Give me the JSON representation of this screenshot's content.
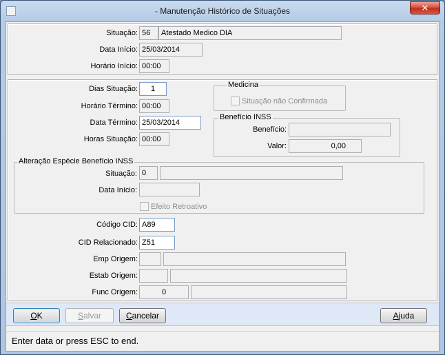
{
  "window": {
    "title": "- Manutenção Histórico de Situações",
    "close_symbol": "✕"
  },
  "top": {
    "situacao_label": "Situação:",
    "situacao_code": "56",
    "situacao_desc": "Atestado Medico DIA",
    "data_inicio_label": "Data Início:",
    "data_inicio": "25/03/2014",
    "horario_inicio_label": "Horário Início:",
    "horario_inicio": "00:00"
  },
  "mid": {
    "dias_situacao_label": "Dias Situação:",
    "dias_situacao": "1",
    "horario_termino_label": "Horário Término:",
    "horario_termino": "00:00",
    "data_termino_label": "Data Término:",
    "data_termino": "25/03/2014",
    "horas_situacao_label": "Horas Situação:",
    "horas_situacao": "00:00",
    "medicina_title": "Medicina",
    "situacao_nao_confirmada": "Situação não Confirmada",
    "beneficio_inss_title": "Benefício INSS",
    "beneficio_label": "Benefício:",
    "beneficio": "",
    "valor_label": "Valor:",
    "valor": "0,00",
    "alteracao_title": "Alteração Espécie Benefício INSS",
    "alt_situacao_label": "Situação:",
    "alt_situacao_code": "0",
    "alt_situacao_desc": "",
    "alt_data_inicio_label": "Data Início:",
    "alt_data_inicio": "",
    "efeito_retroativo": "Efeito Retroativo",
    "codigo_cid_label": "Código CID:",
    "codigo_cid": "A89",
    "cid_relacionado_label": "CID Relacionado:",
    "cid_relacionado": "Z51",
    "emp_origem_label": "Emp Origem:",
    "emp_origem_code": "",
    "emp_origem_desc": "",
    "estab_origem_label": "Estab Origem:",
    "estab_origem_code": "",
    "estab_origem_desc": "",
    "func_origem_label": "Func Origem:",
    "func_origem_code": "0",
    "func_origem_desc": ""
  },
  "buttons": {
    "ok_mnemonic": "O",
    "ok_rest": "K",
    "salvar_mnemonic": "S",
    "salvar_rest": "alvar",
    "cancelar_mnemonic": "C",
    "cancelar_rest": "ancelar",
    "ajuda_mnemonic": "A",
    "ajuda_rest": "juda"
  },
  "status": {
    "text": "Enter data or press ESC to end."
  }
}
